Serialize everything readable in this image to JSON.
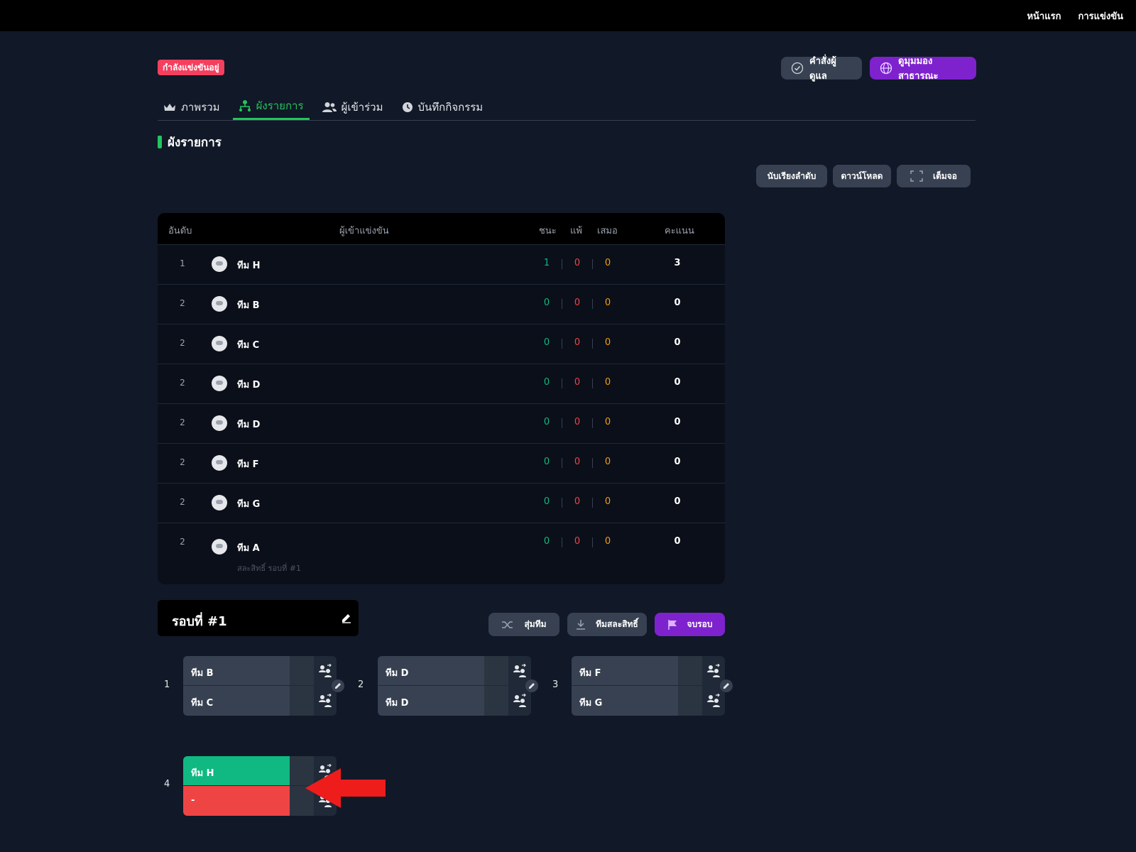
{
  "topnav": {
    "home": "หน้าแรก",
    "competitions": "การแข่งขัน"
  },
  "status_badge": "กำลังแข่งขันอยู่",
  "header_buttons": {
    "admin": "คำสั่งผู้ดูแล",
    "public_view": "ดูมุมมองสาธารณะ"
  },
  "tabs": [
    {
      "label": "ภาพรวม",
      "icon": "crown-icon"
    },
    {
      "label": "ผังรายการ",
      "icon": "bracket-icon",
      "active": true
    },
    {
      "label": "ผู้เข้าร่วม",
      "icon": "users-icon"
    },
    {
      "label": "บันทึกกิจกรรม",
      "icon": "activity-icon"
    }
  ],
  "section_title": "ผังรายการ",
  "tools": {
    "sort": "นับเรียงลำดับ",
    "download": "ดาวน์โหลด",
    "fullscreen": "เต็มจอ"
  },
  "standings": {
    "headers": {
      "rank": "อันดับ",
      "participant": "ผู้เข้าแข่งขัน",
      "win": "ชนะ",
      "loss": "แพ้",
      "draw": "เสมอ",
      "points": "คะแนน"
    },
    "rows": [
      {
        "rank": "1",
        "name": "ทีม H",
        "w": "1",
        "l": "0",
        "d": "0",
        "pts": "3"
      },
      {
        "rank": "2",
        "name": "ทีม B",
        "w": "0",
        "l": "0",
        "d": "0",
        "pts": "0"
      },
      {
        "rank": "2",
        "name": "ทีม C",
        "w": "0",
        "l": "0",
        "d": "0",
        "pts": "0"
      },
      {
        "rank": "2",
        "name": "ทีม D",
        "w": "0",
        "l": "0",
        "d": "0",
        "pts": "0"
      },
      {
        "rank": "2",
        "name": "ทีม D",
        "w": "0",
        "l": "0",
        "d": "0",
        "pts": "0"
      },
      {
        "rank": "2",
        "name": "ทีม F",
        "w": "0",
        "l": "0",
        "d": "0",
        "pts": "0"
      },
      {
        "rank": "2",
        "name": "ทีม G",
        "w": "0",
        "l": "0",
        "d": "0",
        "pts": "0"
      },
      {
        "rank": "2",
        "name": "ทีม A",
        "w": "0",
        "l": "0",
        "d": "0",
        "pts": "0",
        "note": "สละสิทธิ์ รอบที่ #1"
      }
    ]
  },
  "round": {
    "title": "รอบที่ #1",
    "actions": {
      "shuffle": "สุ่มทีม",
      "forfeit": "ทีมสละสิทธิ์",
      "end": "จบรอบ"
    },
    "matches": [
      {
        "num": "1",
        "top": "ทีม B",
        "bottom": "ทีม C"
      },
      {
        "num": "2",
        "top": "ทีม D",
        "bottom": "ทีม D"
      },
      {
        "num": "3",
        "top": "ทีม F",
        "bottom": "ทีม G"
      },
      {
        "num": "4",
        "top": "ทีม H",
        "bottom": "-"
      }
    ]
  },
  "colors": {
    "accent_green": "#22c55e",
    "accent_purple": "#7e22ce",
    "win": "#10b981",
    "loss": "#ef4444",
    "draw": "#f59e0b",
    "badge": "#f43f5e"
  }
}
